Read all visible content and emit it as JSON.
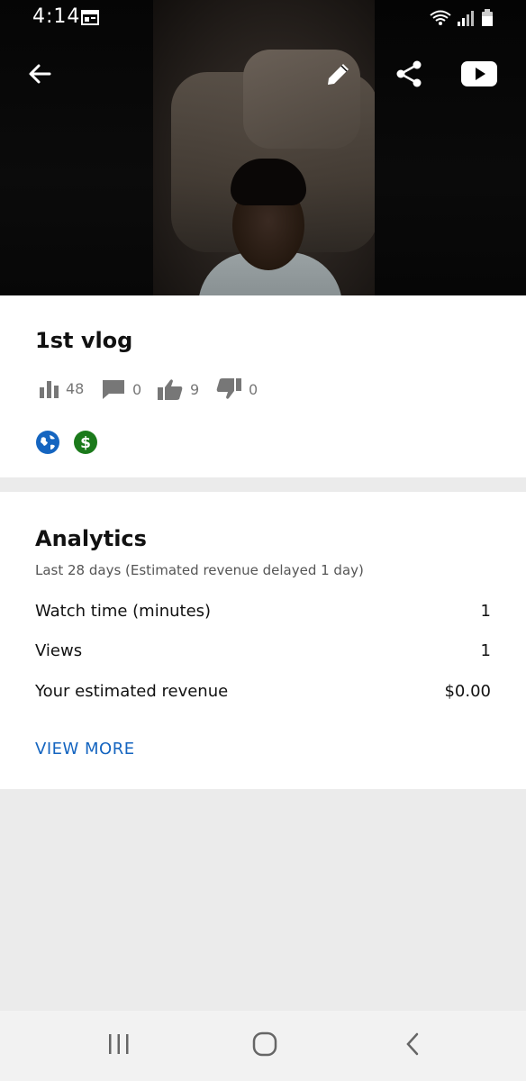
{
  "status_bar": {
    "time": "4:14"
  },
  "video": {
    "back_icon": "arrow-left-icon",
    "edit_icon": "pencil-icon",
    "share_icon": "share-icon",
    "youtube_icon": "youtube-icon"
  },
  "details": {
    "title": "1st vlog",
    "views": "48",
    "comments": "0",
    "likes": "9",
    "dislikes": "0",
    "visibility_icon": "globe-icon",
    "monetization_icon": "dollar-icon",
    "colors": {
      "globe": "#1565c0",
      "dollar": "#1b7a1b"
    }
  },
  "analytics": {
    "title": "Analytics",
    "subtitle": "Last 28 days (Estimated revenue delayed 1 day)",
    "rows": [
      {
        "label": "Watch time (minutes)",
        "value": "1"
      },
      {
        "label": "Views",
        "value": "1"
      },
      {
        "label": "Your estimated revenue",
        "value": "$0.00"
      }
    ],
    "view_more": "VIEW MORE"
  },
  "navbar": {
    "recents_icon": "recents-icon",
    "home_icon": "home-icon",
    "back_icon": "back-chevron-icon"
  }
}
